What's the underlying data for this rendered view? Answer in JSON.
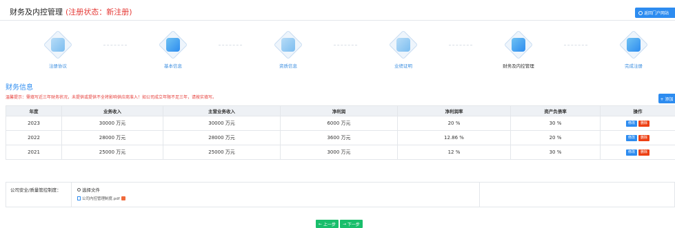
{
  "header": {
    "title": "财务及内控管理",
    "reg_status": "(注册状态：新注册)",
    "back_button": "返回门户网站"
  },
  "steps": [
    {
      "label": "注册协议",
      "icon": "handshake-icon",
      "state": "pending"
    },
    {
      "label": "基本信息",
      "icon": "grid-icon",
      "state": "pending"
    },
    {
      "label": "资质信息",
      "icon": "certificate-icon",
      "state": "pending"
    },
    {
      "label": "业绩证明",
      "icon": "chart-icon",
      "state": "pending"
    },
    {
      "label": "财务及内控管理",
      "icon": "shield-icon",
      "state": "current"
    },
    {
      "label": "完成注册",
      "icon": "flag-icon",
      "state": "pending"
    }
  ],
  "section": {
    "title": "财务信息",
    "tip": "温馨提示：需填写近三年财务状况，未提供或提供不全将影响供应商准入！如公司成立年限不足三年，请按实填写。",
    "add_button": "+ 添加"
  },
  "table": {
    "columns": [
      "年度",
      "业务收入",
      "主营业务收入",
      "净利润",
      "净利润率",
      "资产负债率",
      "操作"
    ],
    "rows": [
      {
        "year": "2023",
        "revenue": "30000 万元",
        "main_revenue": "30000 万元",
        "net_profit": "6000 万元",
        "net_margin": "20 %",
        "debt_ratio": "30 %"
      },
      {
        "year": "2022",
        "revenue": "28000 万元",
        "main_revenue": "28000 万元",
        "net_profit": "3600 万元",
        "net_margin": "12.86 %",
        "debt_ratio": "20 %"
      },
      {
        "year": "2021",
        "revenue": "25000 万元",
        "main_revenue": "25000 万元",
        "net_profit": "3000 万元",
        "net_margin": "12 %",
        "debt_ratio": "30 %"
      }
    ],
    "edit_label": "修改",
    "delete_label": "删除"
  },
  "upload": {
    "label": "公司安全/质量管控制度：",
    "choose_label": "选择文件",
    "file_name": "公司内控管理制度.pdf"
  },
  "nav": {
    "prev": "上一步",
    "next": "下一步"
  },
  "colors": {
    "accent": "#2d8cf0",
    "danger": "#e53935",
    "success": "#19be6b"
  }
}
